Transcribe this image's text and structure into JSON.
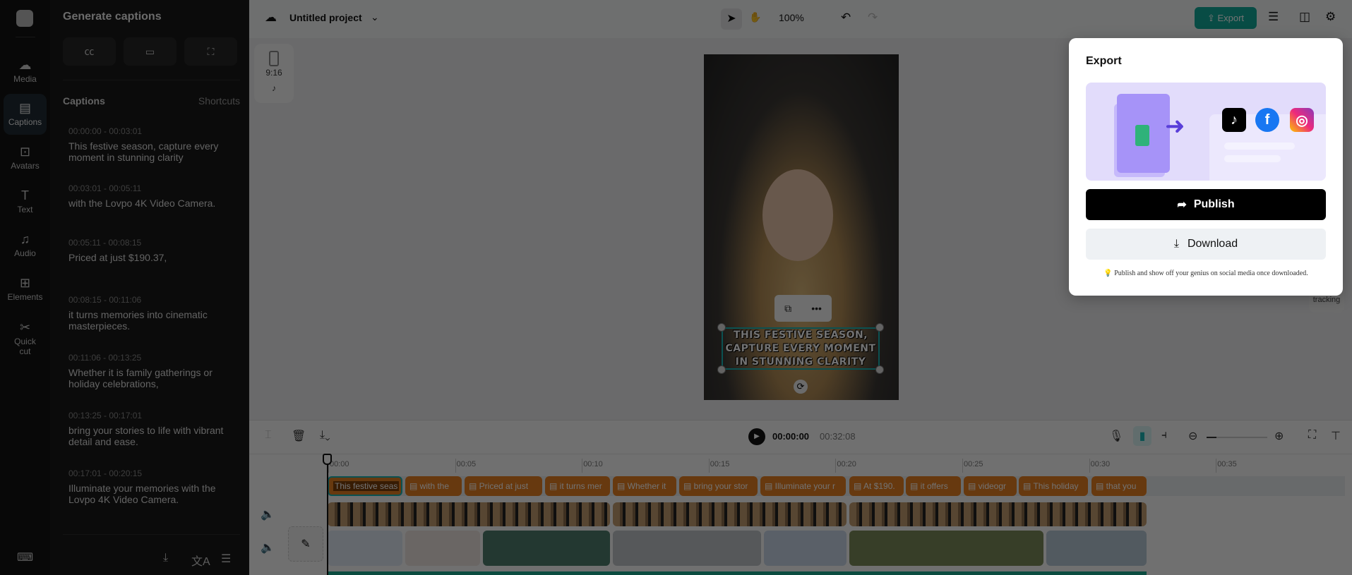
{
  "rail": {
    "items": [
      {
        "label": "Media",
        "icon": "☁"
      },
      {
        "label": "Captions",
        "icon": "▤"
      },
      {
        "label": "Avatars",
        "icon": "⊡"
      },
      {
        "label": "Text",
        "icon": "T"
      },
      {
        "label": "Audio",
        "icon": "♫"
      },
      {
        "label": "Elements",
        "icon": "⊞"
      },
      {
        "label": "Quick cut",
        "icon": "✂"
      }
    ]
  },
  "panel": {
    "title": "Generate captions",
    "captions_heading": "Captions",
    "shortcuts": "Shortcuts",
    "items": [
      {
        "time": "00:00:00 - 00:03:01",
        "text": "This festive season, capture every moment in stunning clarity"
      },
      {
        "time": "00:03:01 - 00:05:11",
        "text": "with the Lovpo 4K Video Camera."
      },
      {
        "time": "00:05:11 - 00:08:15",
        "text": "Priced at just $190.37,"
      },
      {
        "time": "00:08:15 - 00:11:06",
        "text": "it turns memories into cinematic masterpieces."
      },
      {
        "time": "00:11:06 - 00:13:25",
        "text": "Whether it is family gatherings or holiday celebrations,"
      },
      {
        "time": "00:13:25 - 00:17:01",
        "text": "bring your stories to life with vibrant detail and ease."
      },
      {
        "time": "00:17:01 - 00:20:15",
        "text": "Illuminate your memories with the Lovpo 4K Video Camera."
      }
    ]
  },
  "topbar": {
    "project": "Untitled project",
    "zoom": "100%",
    "export": "Export"
  },
  "canvas": {
    "ratio": "9:16",
    "subtitle": [
      "THIS FESTIVE SEASON,",
      "CAPTURE EVERY MOMENT",
      "IN STUNNING CLARITY"
    ],
    "side_label": "tracking"
  },
  "timeline": {
    "current": "00:00:00",
    "total": "00:32:08",
    "ruler": [
      "00:00",
      "00:05",
      "00:10",
      "00:15",
      "00:20",
      "00:25",
      "00:30",
      "00:35"
    ],
    "clips": [
      "This festive seas",
      "with the",
      "Priced at just",
      "it turns mer",
      "Whether it",
      "bring your stor",
      "Illuminate your r",
      "At $190.",
      "it offers",
      "videogr",
      "This holiday",
      "that you"
    ]
  },
  "export_popup": {
    "title": "Export",
    "publish": "Publish",
    "download": "Download",
    "tip": "Publish and show off your genius on social media once downloaded.",
    "socials": [
      "TikTok",
      "Facebook",
      "Instagram"
    ]
  },
  "colors": {
    "accent": "#19b3b3",
    "clip": "#e57e22",
    "export": "#12a89a"
  }
}
